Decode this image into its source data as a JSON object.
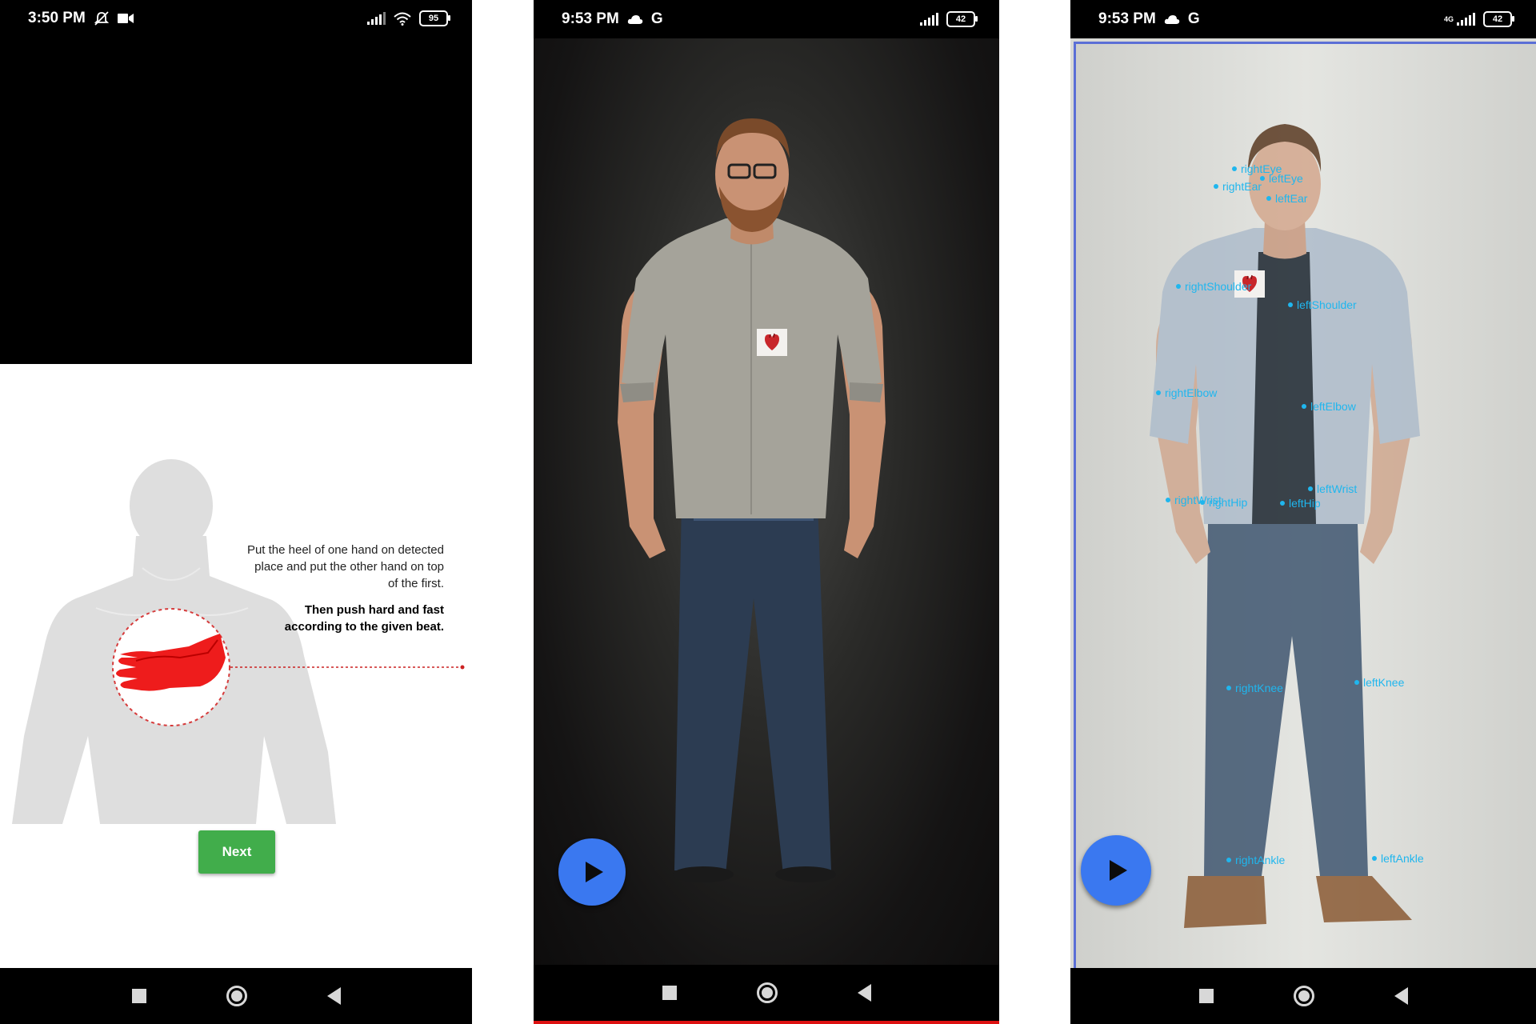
{
  "screen1": {
    "status": {
      "time": "3:50 PM",
      "battery": "95"
    },
    "instruction_text": "Put the heel of one hand on detected place and put the other hand on top of the first.",
    "instruction_bold": "Then push hard and fast according to the given beat.",
    "next_label": "Next",
    "colors": {
      "next_button": "#41ad4b",
      "hands": "#ee1c1c"
    }
  },
  "screen2": {
    "status": {
      "time": "9:53 PM",
      "carrier": "G",
      "battery": "42"
    },
    "icons": [
      "cloud-icon",
      "play-icon",
      "heart-marker-icon"
    ],
    "colors": {
      "fab": "#3a78f0"
    }
  },
  "screen3": {
    "status": {
      "time": "9:53 PM",
      "carrier": "G",
      "network": "4G",
      "battery": "42"
    },
    "keypoints": [
      "rightEye",
      "leftEye",
      "rightEar",
      "leftEar",
      "rightShoulder",
      "leftShoulder",
      "rightElbow",
      "leftElbow",
      "rightWrist",
      "leftWrist",
      "rightHip",
      "leftHip",
      "rightKnee",
      "leftKnee",
      "rightAnkle",
      "leftAnkle"
    ],
    "colors": {
      "keypoint": "#1fb6ee",
      "fab": "#3a78f0"
    }
  }
}
